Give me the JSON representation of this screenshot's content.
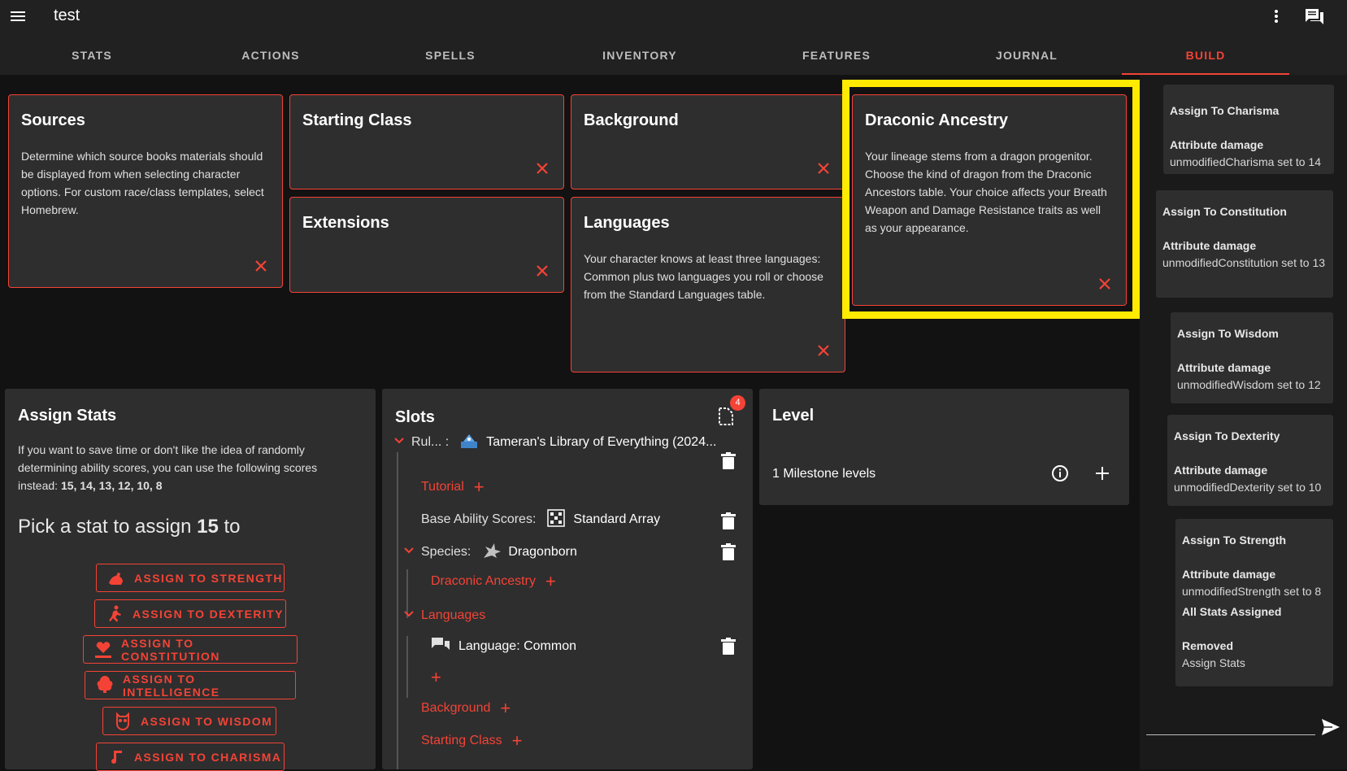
{
  "app": {
    "title": "test"
  },
  "tabs": [
    {
      "label": "STATS"
    },
    {
      "label": "ACTIONS"
    },
    {
      "label": "SPELLS"
    },
    {
      "label": "INVENTORY"
    },
    {
      "label": "FEATURES"
    },
    {
      "label": "JOURNAL"
    },
    {
      "label": "BUILD",
      "active": true
    }
  ],
  "cards": {
    "sources": {
      "title": "Sources",
      "text": "Determine which source books materials should be displayed from when selecting character options. For custom race/class templates, select Homebrew."
    },
    "starting_class": {
      "title": "Starting Class"
    },
    "extensions": {
      "title": "Extensions"
    },
    "background": {
      "title": "Background"
    },
    "languages": {
      "title": "Languages",
      "text": "Your character knows at least three languages: Common plus two languages you roll or choose from the Standard Languages table."
    },
    "draconic": {
      "title": "Draconic Ancestry",
      "text": "Your lineage stems from a dragon progenitor. Choose the kind of dragon from the Draconic Ancestors table. Your choice affects your Breath Weapon and Damage Resistance traits as well as your appearance."
    }
  },
  "assign_stats": {
    "title": "Assign Stats",
    "intro": "If you want to save time or don't like the idea of randomly determining ability scores, you can use the following scores instead: ",
    "scores": "15, 14, 13, 12, 10, 8",
    "pick_prefix": "Pick a stat to assign ",
    "pick_value": "15",
    "pick_suffix": " to",
    "buttons": [
      {
        "label": "ASSIGN TO STRENGTH",
        "icon": "strength-arm-icon"
      },
      {
        "label": "ASSIGN TO DEXTERITY",
        "icon": "running-figure-icon"
      },
      {
        "label": "ASSIGN TO CONSTITUTION",
        "icon": "heart-bar-icon"
      },
      {
        "label": "ASSIGN TO INTELLIGENCE",
        "icon": "brain-icon"
      },
      {
        "label": "ASSIGN TO WISDOM",
        "icon": "owl-icon"
      },
      {
        "label": "ASSIGN TO CHARISMA",
        "icon": "music-note-icon"
      }
    ]
  },
  "slots": {
    "title": "Slots",
    "badge": "4",
    "rules_label": "Rul... :",
    "rules_value": "Tameran's Library of Everything (2024...",
    "tutorial": "Tutorial",
    "base_ability_label": "Base Ability Scores:",
    "base_ability_value": "Standard Array",
    "species_label": "Species:",
    "species_value": "Dragonborn",
    "draconic_ancestry": "Draconic Ancestry",
    "languages": "Languages",
    "language_common": "Language: Common",
    "background": "Background",
    "starting_class": "Starting Class"
  },
  "level": {
    "title": "Level",
    "milestone": "1 Milestone levels"
  },
  "feed": [
    {
      "title": "Assign To Charisma",
      "sub": "Attribute damage",
      "line": "unmodifiedCharisma set to 14"
    },
    {
      "title": "Assign To Constitution",
      "sub": "Attribute damage",
      "line": "unmodifiedConstitution set to 13"
    },
    {
      "title": "Assign To Wisdom",
      "sub": "Attribute damage",
      "line": "unmodifiedWisdom set to 12"
    },
    {
      "title": "Assign To Dexterity",
      "sub": "Attribute damage",
      "line": "unmodifiedDexterity set to 10"
    },
    {
      "title": "Assign To Strength",
      "sub": "Attribute damage",
      "line": "unmodifiedStrength set to 8",
      "extra_title": "All Stats Assigned",
      "extra_sub": "Removed",
      "extra_line": "Assign Stats"
    }
  ],
  "chat": {
    "placeholder": ""
  },
  "colors": {
    "accent": "#f44336",
    "highlight": "#ffea00",
    "background": "#121212",
    "surface": "#2e2e2e"
  }
}
